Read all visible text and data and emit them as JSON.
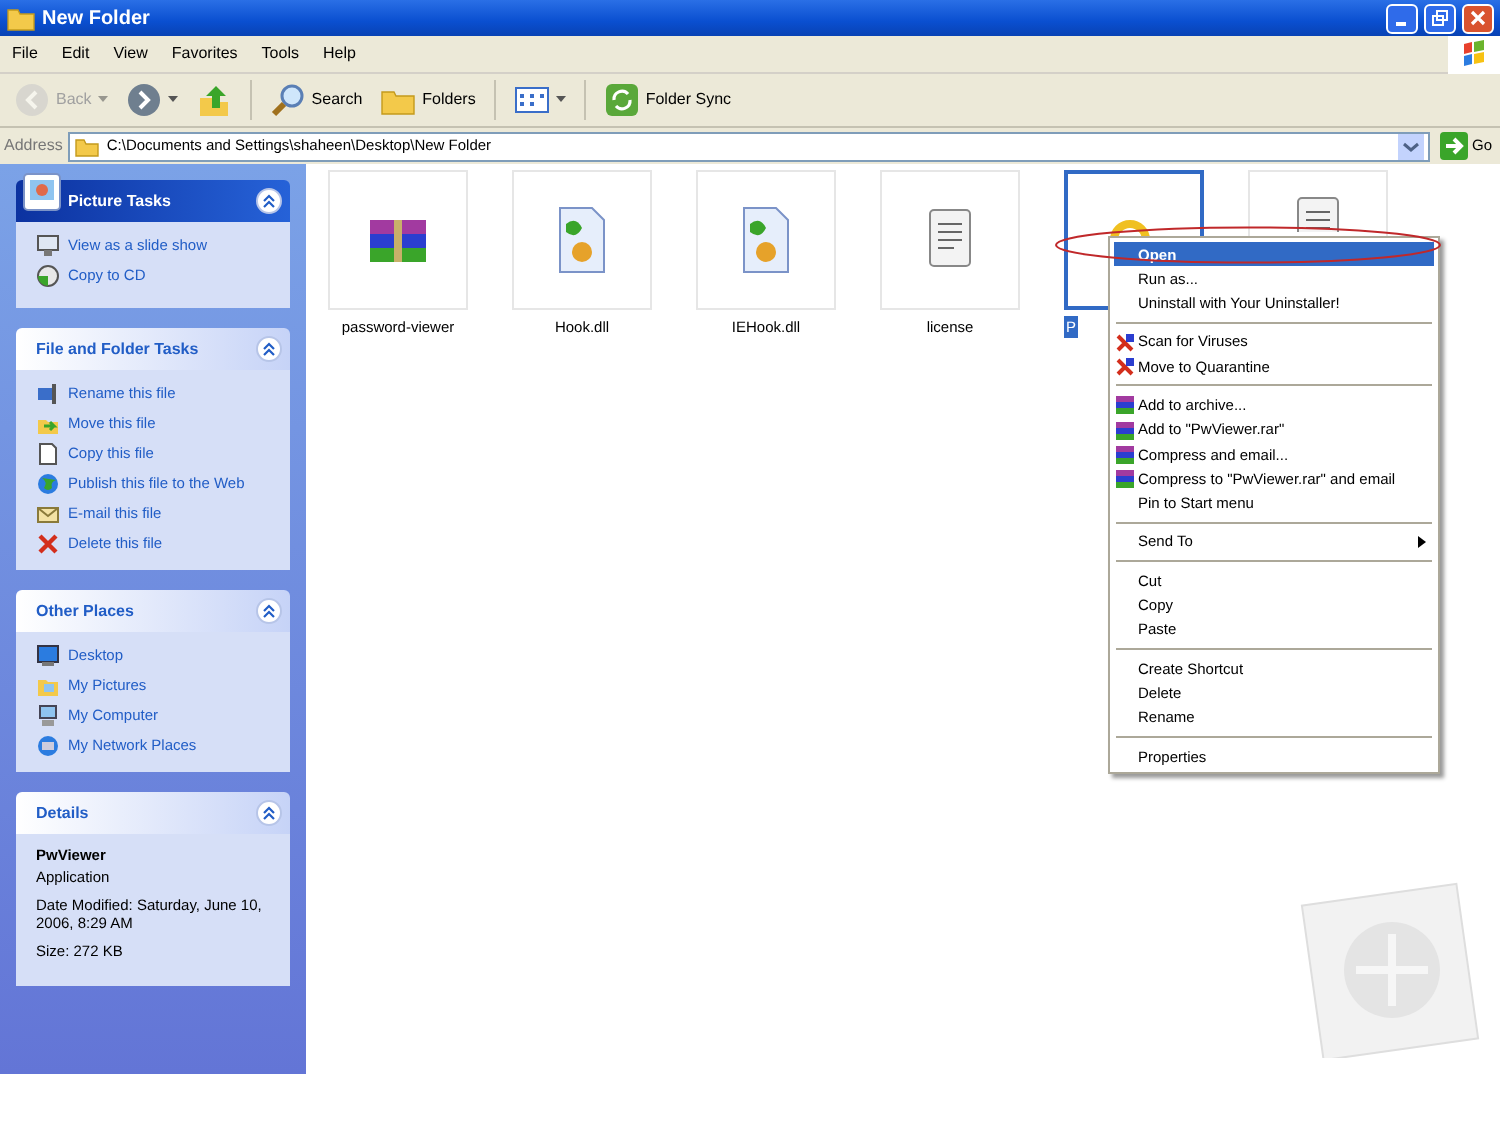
{
  "window": {
    "title": "New Folder"
  },
  "menu": [
    "File",
    "Edit",
    "View",
    "Favorites",
    "Tools",
    "Help"
  ],
  "toolbar": [
    {
      "kind": "back",
      "label": "Back",
      "disabled": true
    },
    {
      "kind": "forward",
      "disabled": false
    },
    {
      "kind": "up",
      "disabled": false
    },
    {
      "kind": "search",
      "label": "Search",
      "disabled": false
    },
    {
      "kind": "folders",
      "label": "Folders",
      "disabled": false
    },
    {
      "kind": "views",
      "disabled": false
    },
    {
      "kind": "sync",
      "label": "Folder Sync",
      "disabled": false
    }
  ],
  "address": {
    "label": "Address",
    "value": "C:\\Documents and Settings\\shaheen\\Desktop\\New Folder",
    "go": "Go"
  },
  "sidebar": [
    {
      "title": "Picture Tasks",
      "kind": "special",
      "items": [
        {
          "label": "View as a slide show",
          "kind": "slideshow"
        },
        {
          "label": "Copy to CD",
          "kind": "cd"
        }
      ]
    },
    {
      "title": "File and Folder Tasks",
      "kind": "normal",
      "items": [
        {
          "label": "Rename this file",
          "kind": "rename"
        },
        {
          "label": "Move this file",
          "kind": "move"
        },
        {
          "label": "Copy this file",
          "kind": "copy"
        },
        {
          "label": "Publish this file to the Web",
          "kind": "publish"
        },
        {
          "label": "E-mail this file",
          "kind": "email"
        },
        {
          "label": "Delete this file",
          "kind": "delete"
        }
      ]
    },
    {
      "title": "Other Places",
      "kind": "normal",
      "items": [
        {
          "label": "Desktop",
          "kind": "desktop"
        },
        {
          "label": "My Pictures",
          "kind": "pictures"
        },
        {
          "label": "My Computer",
          "kind": "computer"
        },
        {
          "label": "My Network Places",
          "kind": "network"
        }
      ]
    },
    {
      "title": "Details",
      "kind": "details",
      "details": {
        "name": "PwViewer",
        "type": "Application",
        "modified": "Date Modified: Saturday, June 10, 2006, 8:29 AM",
        "size": "Size: 272 KB"
      }
    }
  ],
  "files": [
    {
      "label": "password-viewer",
      "kind": "archive",
      "selected": false
    },
    {
      "label": "Hook.dll",
      "kind": "dll",
      "selected": false
    },
    {
      "label": "IEHook.dll",
      "kind": "dll",
      "selected": false
    },
    {
      "label": "license",
      "kind": "text",
      "selected": false
    },
    {
      "label": "P",
      "kind": "app",
      "selected": true
    },
    {
      "kind": "text",
      "selected": false
    }
  ],
  "context_menu": {
    "items": [
      {
        "label": "Open",
        "kind": "plain",
        "selected": true,
        "default": true
      },
      {
        "label": "Run as...",
        "kind": "plain",
        "selected": false,
        "default": false
      },
      {
        "label": "Uninstall with Your Uninstaller!",
        "kind": "plain",
        "selected": false,
        "default": false
      },
      {
        "kind": "separator"
      },
      {
        "label": "Scan for Viruses",
        "kind": "antivirus",
        "selected": false,
        "default": false
      },
      {
        "label": "Move to Quarantine",
        "kind": "antivirus",
        "selected": false,
        "default": false
      },
      {
        "kind": "separator"
      },
      {
        "label": "Add to archive...",
        "kind": "archive",
        "selected": false,
        "default": false
      },
      {
        "label": "Add to \"PwViewer.rar\"",
        "kind": "archive",
        "selected": false,
        "default": false
      },
      {
        "label": "Compress and email...",
        "kind": "archive",
        "selected": false,
        "default": false
      },
      {
        "label": "Compress to \"PwViewer.rar\" and email",
        "kind": "archive",
        "selected": false,
        "default": false
      },
      {
        "label": "Pin to Start menu",
        "kind": "plain",
        "selected": false,
        "default": false
      },
      {
        "kind": "separator"
      },
      {
        "label": "Send To",
        "kind": "submenu",
        "selected": false,
        "default": false
      },
      {
        "kind": "separator"
      },
      {
        "label": "Cut",
        "kind": "plain",
        "selected": false,
        "default": false
      },
      {
        "label": "Copy",
        "kind": "plain",
        "selected": false,
        "default": false
      },
      {
        "label": "Paste",
        "kind": "plain",
        "selected": false,
        "default": false
      },
      {
        "kind": "separator"
      },
      {
        "label": "Create Shortcut",
        "kind": "plain",
        "selected": false,
        "default": false
      },
      {
        "label": "Delete",
        "kind": "plain",
        "selected": false,
        "default": false
      },
      {
        "label": "Rename",
        "kind": "plain",
        "selected": false,
        "default": false
      },
      {
        "kind": "separator"
      },
      {
        "label": "Properties",
        "kind": "plain",
        "selected": false,
        "default": false
      }
    ]
  }
}
